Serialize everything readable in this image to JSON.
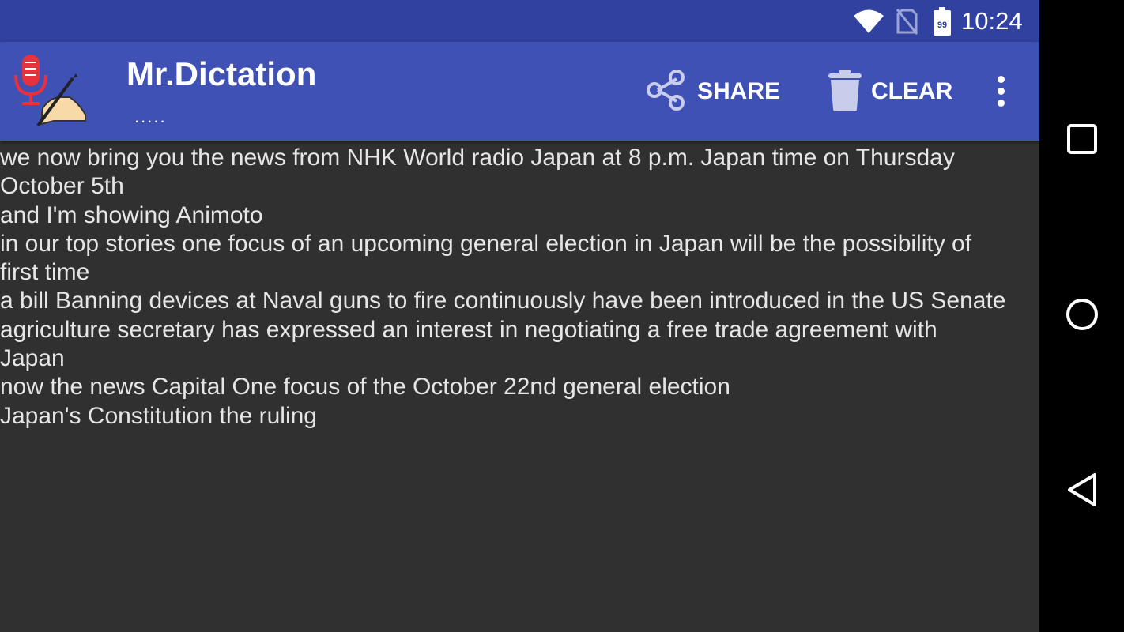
{
  "status_bar": {
    "time": "10:24",
    "battery_level": "99",
    "icons": [
      "wifi-icon",
      "no-sim-icon",
      "battery-icon"
    ]
  },
  "app_bar": {
    "title": "Mr.Dictation",
    "subtitle": ".....",
    "actions": {
      "share_label": "SHARE",
      "clear_label": "CLEAR"
    }
  },
  "transcript": {
    "lines": [
      "we now bring you the news from NHK World radio Japan at 8 p.m. Japan time on Thursday",
      "October 5th",
      "and I'm showing Animoto",
      "in our top stories one focus of an upcoming general election in Japan will be the possibility of",
      "first time",
      "a bill Banning devices at Naval guns to fire continuously have been introduced in the US Senate",
      "agriculture secretary has expressed an interest in negotiating a free trade agreement with",
      "Japan",
      "now the news Capital One focus of the October 22nd general election",
      "Japan's Constitution the ruling"
    ]
  },
  "colors": {
    "status_bar": "#3141a0",
    "app_bar": "#3f51b5",
    "content_background": "#303030",
    "text": "#e6e6e6"
  }
}
